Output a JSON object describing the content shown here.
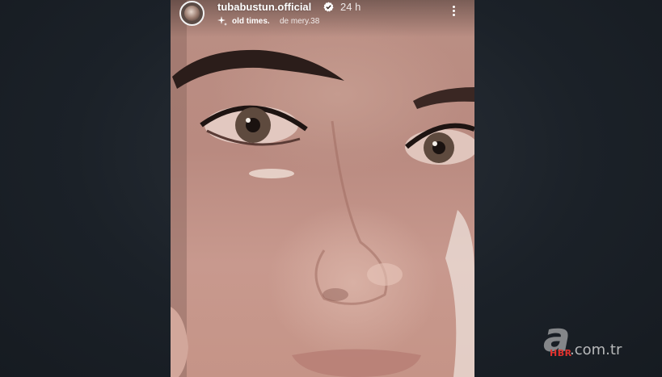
{
  "story": {
    "username": "tubabustun.official",
    "time": "24 h",
    "music": {
      "title": "old times.",
      "artist": "de mery.38",
      "icon": "sparkle-icon"
    }
  },
  "watermark": {
    "logo_letter": "a",
    "brand": "HBR",
    "domain": ".com.tr"
  },
  "colors": {
    "backdrop": "#1b2128",
    "skin": "#bb8f84",
    "watermark_red": "#e0322e"
  }
}
